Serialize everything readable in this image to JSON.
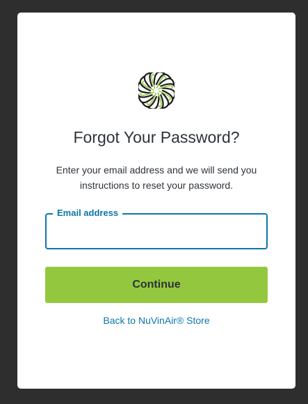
{
  "logo": {
    "icon": "spiral-swirl-logo-icon",
    "colors": {
      "dark": "#1c1c1c",
      "accent": "#93c83e"
    }
  },
  "heading": "Forgot Your Password?",
  "description": "Enter your email address and we will send you instructions to reset your password.",
  "email_field": {
    "label": "Email address",
    "value": ""
  },
  "continue_button": {
    "label": "Continue",
    "color": "#93c83e"
  },
  "back_link": {
    "label": "Back to NuVinAir® Store",
    "color": "#0b77a8"
  },
  "colors": {
    "background": "#2e2e2e",
    "card": "#ffffff",
    "focus_border": "#0b77a8"
  }
}
